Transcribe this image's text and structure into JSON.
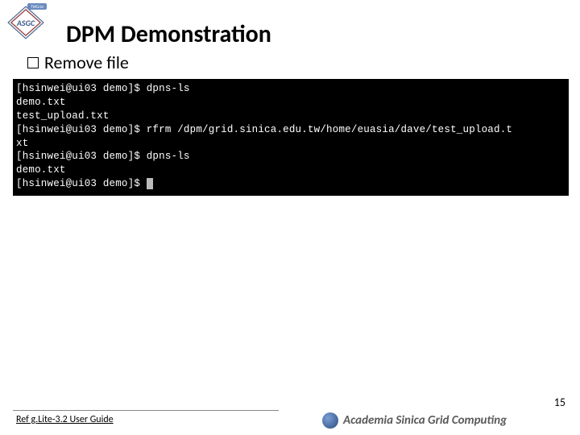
{
  "logo": {
    "text": "ASGC",
    "ribbon": "TWGrid"
  },
  "title": "DPM Demonstration",
  "bullet": {
    "label": "Remove file"
  },
  "terminal": {
    "lines": [
      "[hsinwei@ui03 demo]$ dpns-ls",
      "demo.txt",
      "test_upload.txt",
      "[hsinwei@ui03 demo]$ rfrm /dpm/grid.sinica.edu.tw/home/euasia/dave/test_upload.t",
      "xt",
      "[hsinwei@ui03 demo]$ dpns-ls",
      "demo.txt",
      "[hsinwei@ui03 demo]$ "
    ]
  },
  "footer": {
    "ref": "Ref g.Lite-3.2 User Guide",
    "page": "15",
    "org": "Academia Sinica Grid Computing"
  }
}
